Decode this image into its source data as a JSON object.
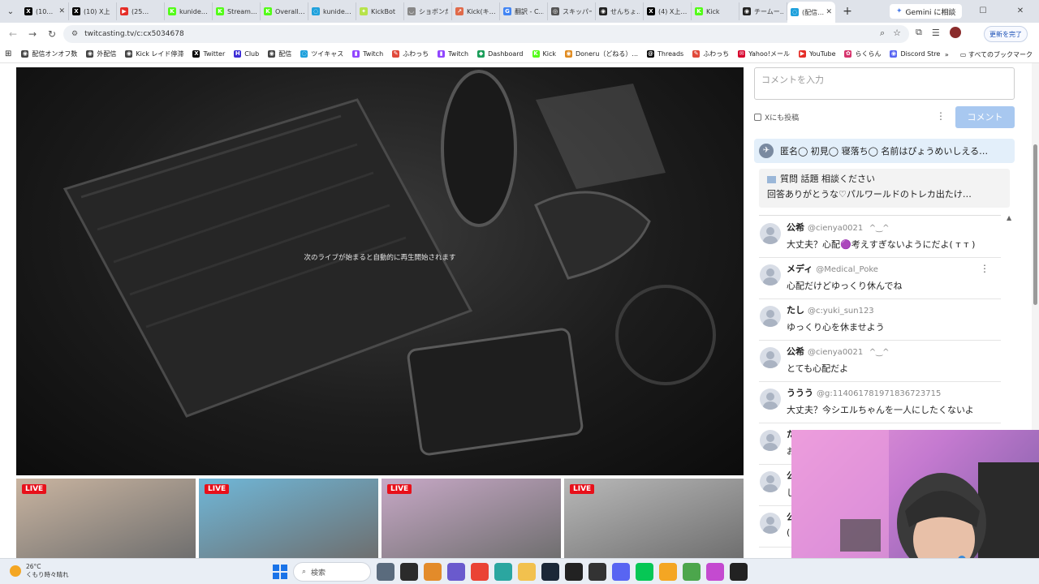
{
  "browser": {
    "tabs": [
      {
        "title": "(10…",
        "icon_color": "#000000",
        "icon_letter": "X"
      },
      {
        "title": "(10) X上",
        "icon_color": "#000000",
        "icon_letter": "X"
      },
      {
        "title": "(25…",
        "icon_color": "#e52d27",
        "icon_letter": "▶"
      },
      {
        "title": "kunide…",
        "icon_color": "#53fc18",
        "icon_letter": "K"
      },
      {
        "title": "Stream…",
        "icon_color": "#53fc18",
        "icon_letter": "K"
      },
      {
        "title": "Overall…",
        "icon_color": "#53fc18",
        "icon_letter": "K"
      },
      {
        "title": "kunide…",
        "icon_color": "#1fa1dc",
        "icon_letter": "◌"
      },
      {
        "title": "KickBot",
        "icon_color": "#b7e34a",
        "icon_letter": "✦"
      },
      {
        "title": "ショボンだ",
        "icon_color": "#888888",
        "icon_letter": "◡"
      },
      {
        "title": "Kick(キ…",
        "icon_color": "#e06a4a",
        "icon_letter": "↗"
      },
      {
        "title": "翻訳 - C…",
        "icon_color": "#4285f4",
        "icon_letter": "G"
      },
      {
        "title": "スキッパー",
        "icon_color": "#555555",
        "icon_letter": "◎"
      },
      {
        "title": "せんちょ…",
        "icon_color": "#222222",
        "icon_letter": "◉"
      },
      {
        "title": "(4) X上…",
        "icon_color": "#000000",
        "icon_letter": "X"
      },
      {
        "title": "Kick",
        "icon_color": "#53fc18",
        "icon_letter": "K"
      },
      {
        "title": "チームー…",
        "icon_color": "#222222",
        "icon_letter": "◉"
      },
      {
        "title": "(配信…",
        "icon_color": "#1fa1dc",
        "icon_letter": "◌",
        "active": true
      }
    ],
    "new_tab_label": "+",
    "gemini_button": "Gemini に相談",
    "url": "twitcasting.tv/c:cx5034678",
    "update_button": "更新を完了",
    "window_controls": {
      "minimize": "–",
      "maximize": "☐",
      "close": "✕"
    }
  },
  "bookmarks": [
    {
      "label": "配信オンオフ数",
      "icon_color": "#444444",
      "icon": "◉"
    },
    {
      "label": "外配信",
      "icon_color": "#444444",
      "icon": "◉"
    },
    {
      "label": "Kick レイド停滞",
      "icon_color": "#444444",
      "icon": "◉"
    },
    {
      "label": "Twitter",
      "icon_color": "#000000",
      "icon": "X"
    },
    {
      "label": "Club",
      "icon_color": "#3b2bd6",
      "icon": "H"
    },
    {
      "label": "配信",
      "icon_color": "#444444",
      "icon": "◉"
    },
    {
      "label": "ツイキャス",
      "icon_color": "#1fa1dc",
      "icon": "◌"
    },
    {
      "label": "Twitch",
      "icon_color": "#9146ff",
      "icon": "▮"
    },
    {
      "label": "ふわっち",
      "icon_color": "#e0493a",
      "icon": "✎"
    },
    {
      "label": "Twitch",
      "icon_color": "#9146ff",
      "icon": "▮"
    },
    {
      "label": "Dashboard",
      "icon_color": "#1b9e5a",
      "icon": "◆"
    },
    {
      "label": "Kick",
      "icon_color": "#53fc18",
      "icon": "K"
    },
    {
      "label": "Doneru（どねる）...",
      "icon_color": "#e08a1e",
      "icon": "◉"
    },
    {
      "label": "Threads",
      "icon_color": "#000000",
      "icon": "@"
    },
    {
      "label": "ふわっち",
      "icon_color": "#e0493a",
      "icon": "✎"
    },
    {
      "label": "Yahoo!メール",
      "icon_color": "#d6002b",
      "icon": "✉"
    },
    {
      "label": "YouTube",
      "icon_color": "#e52d27",
      "icon": "▶"
    },
    {
      "label": "らくらん",
      "icon_color": "#d6336c",
      "icon": "✿"
    },
    {
      "label": "Discord StreamKit O...",
      "icon_color": "#5865f2",
      "icon": "◉"
    }
  ],
  "bookmarks_more": "»",
  "bookmarks_all": "すべてのブックマーク",
  "player": {
    "message": "次のライブが始まると自動的に再生開始されます"
  },
  "live_thumbs": [
    {
      "badge": "LIVE",
      "bg": "#c9b4a0"
    },
    {
      "badge": "LIVE",
      "bg": "#6fb7d8"
    },
    {
      "badge": "LIVE",
      "bg": "#c7a8c6"
    },
    {
      "badge": "LIVE",
      "bg": "#b8b8b8"
    }
  ],
  "comment_panel": {
    "input_placeholder": "コメントを入力",
    "x_post_label": "Xにも投稿",
    "submit_label": "コメント",
    "pinned": "匿名◯ 初見◯ 寝落ち◯ 名前はぴょうめいしえる…",
    "qa_line1": "質問 話題 相談ください",
    "qa_line2": "回答ありがとうな♡パルワールドのトレカ出たけ…",
    "comments": [
      {
        "name": "公希",
        "handle": "@cienya0021",
        "emote": "^‿^",
        "text": "大丈夫？心配🟣考えすぎないようにだよ( ᴛ ᴛ )"
      },
      {
        "name": "メディ",
        "handle": "@Medical_Poke",
        "emote": "",
        "text": "心配だけどゆっくり休んでね",
        "menu": "⋮"
      },
      {
        "name": "たし",
        "handle": "@c:yuki_sun123",
        "emote": "",
        "text": "ゆっくり心を休ませよう"
      },
      {
        "name": "公希",
        "handle": "@cienya0021",
        "emote": "^‿^",
        "text": "とても心配だよ"
      },
      {
        "name": "ううう",
        "handle": "@g:114061781971836723715",
        "emote": "",
        "text": "大丈夫？今シエルちゃんを一人にしたくないよ"
      },
      {
        "name": "た",
        "handle": "",
        "emote": "",
        "text": "お"
      },
      {
        "name": "公",
        "handle": "",
        "emote": "",
        "text": "じ"
      },
      {
        "name": "公",
        "handle": "",
        "emote": "",
        "text": "("
      }
    ]
  },
  "taskbar": {
    "weather_temp": "26°C",
    "weather_desc": "くもり時々晴れ",
    "search_label": "検索",
    "apps": [
      "#5a6b7d",
      "#2b2b2b",
      "#e38b2a",
      "#6a5acd",
      "#ea4335",
      "#2ba6a0",
      "#f2c14e",
      "#1b2838",
      "#222222",
      "#333333",
      "#5865f2",
      "#06c755",
      "#f4a623",
      "#4ca64c",
      "#c44ad0",
      "#222222"
    ]
  }
}
